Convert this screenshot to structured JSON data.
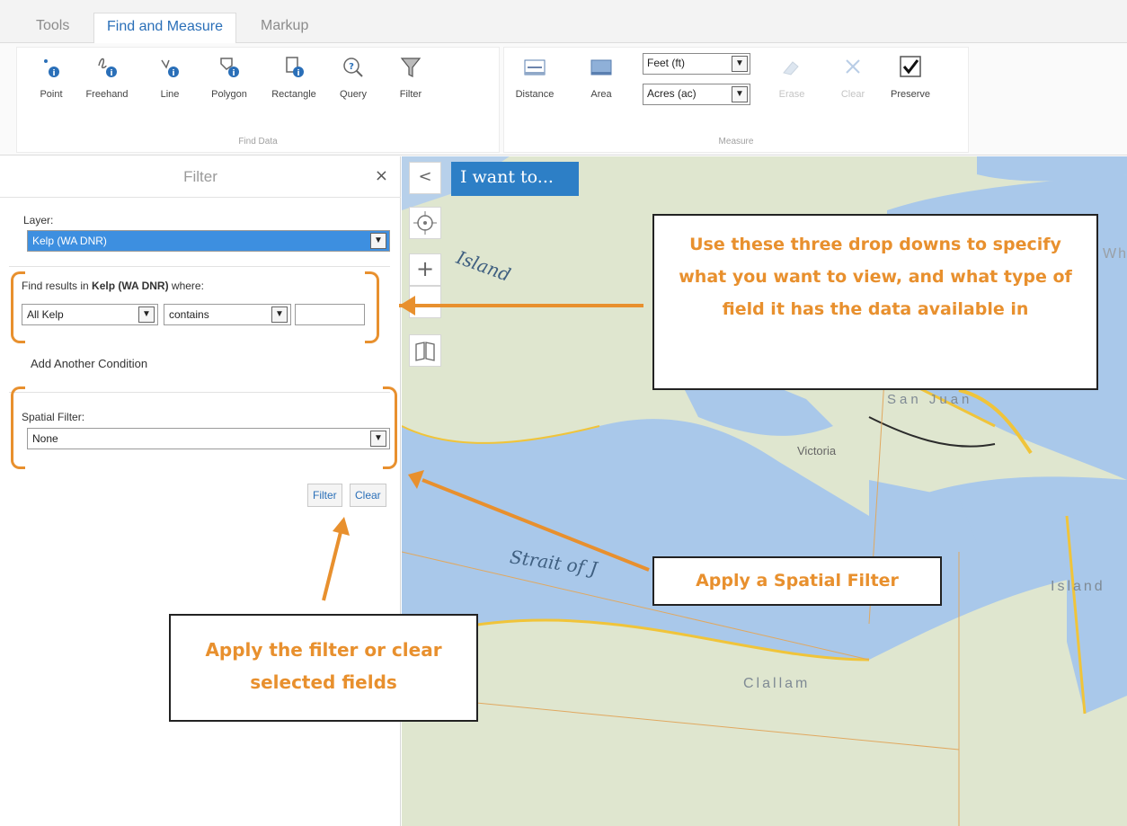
{
  "tabs": [
    "Tools",
    "Find and Measure",
    "Markup"
  ],
  "ribbon": {
    "find_data_label": "Find Data",
    "measure_label": "Measure",
    "find_buttons": [
      "Point",
      "Freehand",
      "Line",
      "Polygon",
      "Rectangle",
      "Query",
      "Filter"
    ],
    "measure_buttons": [
      "Distance",
      "Area"
    ],
    "length_unit": "Feet (ft)",
    "area_unit": "Acres (ac)",
    "erase": "Erase",
    "clear": "Clear",
    "preserve": "Preserve",
    "preserve_checked": true
  },
  "panel": {
    "title": "Filter",
    "close": "×",
    "layer_label": "Layer:",
    "layer_value": "Kelp (WA DNR)",
    "find_prefix": "Find results in ",
    "find_layer": "Kelp (WA DNR)",
    "find_suffix": " where:",
    "field_value": "All Kelp",
    "operator_value": "contains",
    "condition_value": "",
    "add_condition": "Add Another Condition",
    "spatial_label": "Spatial Filter:",
    "spatial_value": "None",
    "filter_button": "Filter",
    "clear_button": "Clear"
  },
  "map": {
    "collapse_icon": "<",
    "iwant": "I want to...",
    "labels": {
      "island": "Island",
      "strait": "Strait of J",
      "victoria": "Victoria",
      "clallam": "Clallam",
      "san_juan": "San Juan",
      "wh": "Wh",
      "island_right": "Island"
    }
  },
  "callouts": {
    "dropdowns": "Use these three drop downs to specify what you want to view, and what type of field it has the data available in",
    "spatial": "Apply a Spatial Filter",
    "apply": "Apply the filter or clear selected fields"
  },
  "colors": {
    "accent": "#2d7fc6",
    "callout": "#e8902e",
    "water": "#a9c8ea",
    "land": "#dfe6cf"
  }
}
